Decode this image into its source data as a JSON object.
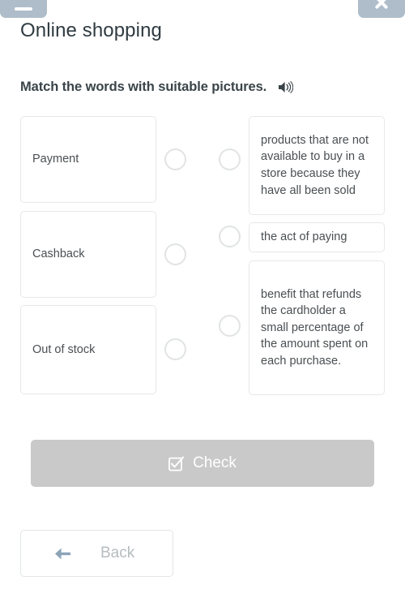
{
  "window": {
    "minimize_button": {
      "icon": "minimize-icon",
      "label": ""
    },
    "close_button": {
      "icon": "close-icon",
      "label": ""
    }
  },
  "header": {
    "title": "Online shopping",
    "instruction": "Match the words with suitable pictures.",
    "audio_icon": "speaker-icon"
  },
  "matching": {
    "left_items": [
      {
        "label": "Payment"
      },
      {
        "label": "Cashback"
      },
      {
        "label": "Out of stock"
      }
    ],
    "right_items": [
      {
        "label": "products that are not available to buy in a store because they have all been sold"
      },
      {
        "label": "the act of paying"
      },
      {
        "label": "benefit that refunds the cardholder a small percentage of the amount spent on each purchase."
      }
    ]
  },
  "actions": {
    "check_label": "Check",
    "check_icon": "checkbox-icon",
    "back_label": "Back",
    "back_icon": "arrow-left-icon"
  },
  "colors": {
    "chrome": "#aebdc9",
    "title_text": "#2f3b41",
    "instruction_text": "#3a4449",
    "card_border": "#e6e8e9",
    "dot_border": "#e1e3e4",
    "check_bg": "#c9c9c9",
    "check_text": "#ffffff",
    "back_text": "#b6bcbf",
    "back_arrow": "#8ca4b8",
    "page_bg": "#ffffff"
  }
}
